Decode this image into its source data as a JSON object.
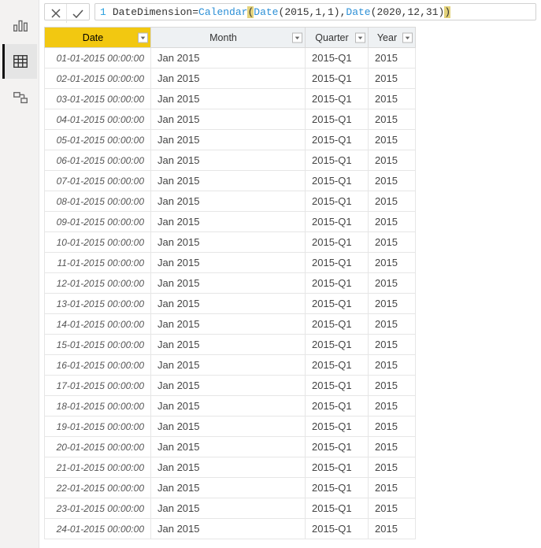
{
  "view_rail": {
    "items": [
      {
        "name": "report-view"
      },
      {
        "name": "data-view"
      },
      {
        "name": "model-view"
      }
    ],
    "active_index": 1
  },
  "formula_bar": {
    "line_number": "1",
    "table_name": "DateDimension",
    "equals": " = ",
    "fn_calendar": "Calendar",
    "open1": "(",
    "space1": " ",
    "fn_date1": "Date",
    "open2": "(",
    "arg2015": "2015",
    "comma1": ", ",
    "arg1a": "1",
    "comma2": ", ",
    "arg1b": "1",
    "close2": ")",
    "comma3": ", ",
    "fn_date2": "Date",
    "open3": "(",
    "arg2020": "2020",
    "comma4": ",",
    "arg12": "12",
    "comma5": ",",
    "arg31": "31",
    "close3": ")",
    "close1": ")"
  },
  "columns": [
    {
      "key": "date",
      "label": "Date",
      "selected": true
    },
    {
      "key": "month",
      "label": "Month",
      "selected": false
    },
    {
      "key": "quarter",
      "label": "Quarter",
      "selected": false
    },
    {
      "key": "year",
      "label": "Year",
      "selected": false
    }
  ],
  "rows": [
    {
      "date": "01-01-2015 00:00:00",
      "month": "Jan 2015",
      "quarter": "2015-Q1",
      "year": "2015"
    },
    {
      "date": "02-01-2015 00:00:00",
      "month": "Jan 2015",
      "quarter": "2015-Q1",
      "year": "2015"
    },
    {
      "date": "03-01-2015 00:00:00",
      "month": "Jan 2015",
      "quarter": "2015-Q1",
      "year": "2015"
    },
    {
      "date": "04-01-2015 00:00:00",
      "month": "Jan 2015",
      "quarter": "2015-Q1",
      "year": "2015"
    },
    {
      "date": "05-01-2015 00:00:00",
      "month": "Jan 2015",
      "quarter": "2015-Q1",
      "year": "2015"
    },
    {
      "date": "06-01-2015 00:00:00",
      "month": "Jan 2015",
      "quarter": "2015-Q1",
      "year": "2015"
    },
    {
      "date": "07-01-2015 00:00:00",
      "month": "Jan 2015",
      "quarter": "2015-Q1",
      "year": "2015"
    },
    {
      "date": "08-01-2015 00:00:00",
      "month": "Jan 2015",
      "quarter": "2015-Q1",
      "year": "2015"
    },
    {
      "date": "09-01-2015 00:00:00",
      "month": "Jan 2015",
      "quarter": "2015-Q1",
      "year": "2015"
    },
    {
      "date": "10-01-2015 00:00:00",
      "month": "Jan 2015",
      "quarter": "2015-Q1",
      "year": "2015"
    },
    {
      "date": "11-01-2015 00:00:00",
      "month": "Jan 2015",
      "quarter": "2015-Q1",
      "year": "2015"
    },
    {
      "date": "12-01-2015 00:00:00",
      "month": "Jan 2015",
      "quarter": "2015-Q1",
      "year": "2015"
    },
    {
      "date": "13-01-2015 00:00:00",
      "month": "Jan 2015",
      "quarter": "2015-Q1",
      "year": "2015"
    },
    {
      "date": "14-01-2015 00:00:00",
      "month": "Jan 2015",
      "quarter": "2015-Q1",
      "year": "2015"
    },
    {
      "date": "15-01-2015 00:00:00",
      "month": "Jan 2015",
      "quarter": "2015-Q1",
      "year": "2015"
    },
    {
      "date": "16-01-2015 00:00:00",
      "month": "Jan 2015",
      "quarter": "2015-Q1",
      "year": "2015"
    },
    {
      "date": "17-01-2015 00:00:00",
      "month": "Jan 2015",
      "quarter": "2015-Q1",
      "year": "2015"
    },
    {
      "date": "18-01-2015 00:00:00",
      "month": "Jan 2015",
      "quarter": "2015-Q1",
      "year": "2015"
    },
    {
      "date": "19-01-2015 00:00:00",
      "month": "Jan 2015",
      "quarter": "2015-Q1",
      "year": "2015"
    },
    {
      "date": "20-01-2015 00:00:00",
      "month": "Jan 2015",
      "quarter": "2015-Q1",
      "year": "2015"
    },
    {
      "date": "21-01-2015 00:00:00",
      "month": "Jan 2015",
      "quarter": "2015-Q1",
      "year": "2015"
    },
    {
      "date": "22-01-2015 00:00:00",
      "month": "Jan 2015",
      "quarter": "2015-Q1",
      "year": "2015"
    },
    {
      "date": "23-01-2015 00:00:00",
      "month": "Jan 2015",
      "quarter": "2015-Q1",
      "year": "2015"
    },
    {
      "date": "24-01-2015 00:00:00",
      "month": "Jan 2015",
      "quarter": "2015-Q1",
      "year": "2015"
    }
  ]
}
